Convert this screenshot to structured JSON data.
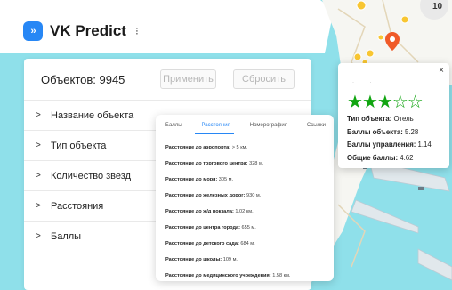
{
  "app": {
    "name": "VK Predict",
    "menu_glyph": "⁝",
    "logo_glyph": "›› "
  },
  "filters": {
    "count_label": "Объектов: 9945",
    "apply_label": "Применить",
    "reset_label": "Сбросить",
    "items": [
      {
        "label": "Название объекта"
      },
      {
        "label": "Тип объекта"
      },
      {
        "label": "Количество звезд"
      },
      {
        "label": "Расстояния"
      },
      {
        "label": "Баллы"
      }
    ]
  },
  "popup": {
    "tabs": [
      "Баллы",
      "Расстояния",
      "Номерография",
      "Ссылки"
    ],
    "active_tab": 1,
    "distances": [
      {
        "label": "Расстояние до аэропорта:",
        "value": "> 5 км."
      },
      {
        "label": "Расстояние до торгового центра:",
        "value": "328 м."
      },
      {
        "label": "Расстояние до моря:",
        "value": "305 м."
      },
      {
        "label": "Расстояние до железных дорог:",
        "value": "930 м."
      },
      {
        "label": "Расстояние до ж/д вокзала:",
        "value": "1.02 км."
      },
      {
        "label": "Расстояние до центра города:",
        "value": "655 м."
      },
      {
        "label": "Расстояние до детского сада:",
        "value": "684 м."
      },
      {
        "label": "Расстояние до школы:",
        "value": "109 м."
      },
      {
        "label": "Расстояние до медицинского учреждения:",
        "value": "1.58 км."
      }
    ]
  },
  "card": {
    "close": "×",
    "rating": 3,
    "max_rating": 5,
    "fields": [
      {
        "label": "Тип объекта:",
        "value": "Отель"
      },
      {
        "label": "Баллы объекта:",
        "value": "5.28"
      },
      {
        "label": "Баллы управления:",
        "value": "1.14"
      },
      {
        "label": "Общие баллы:",
        "value": "4.62"
      }
    ]
  },
  "map": {
    "corner_label": "10",
    "water_color": "#8fe0ea",
    "land_color": "#f6f6f2",
    "accent_color": "#2787f5",
    "star_color": "#10a510"
  }
}
